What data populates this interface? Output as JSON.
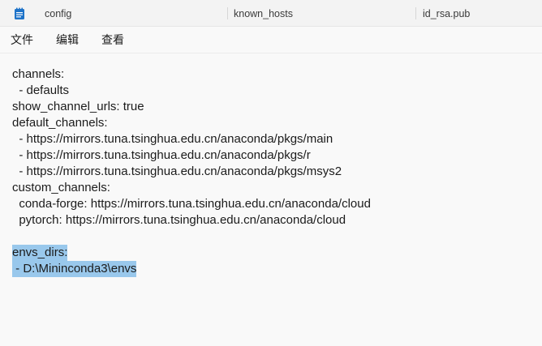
{
  "tabs": [
    {
      "label": "config",
      "active": true
    },
    {
      "label": "known_hosts",
      "active": false
    },
    {
      "label": "id_rsa.pub",
      "active": false
    }
  ],
  "menu": {
    "file": "文件",
    "edit": "编辑",
    "view": "查看"
  },
  "editor": {
    "lines": [
      "channels:",
      "  - defaults",
      "show_channel_urls: true",
      "default_channels:",
      "  - https://mirrors.tuna.tsinghua.edu.cn/anaconda/pkgs/main",
      "  - https://mirrors.tuna.tsinghua.edu.cn/anaconda/pkgs/r",
      "  - https://mirrors.tuna.tsinghua.edu.cn/anaconda/pkgs/msys2",
      "custom_channels:",
      "  conda-forge: https://mirrors.tuna.tsinghua.edu.cn/anaconda/cloud",
      "  pytorch: https://mirrors.tuna.tsinghua.edu.cn/anaconda/cloud",
      "",
      "envs_dirs:",
      " - D:\\Mininconda3\\envs"
    ],
    "selected_lines": [
      11,
      12
    ]
  },
  "colors": {
    "selection": "#99c8ec",
    "icon_blue": "#1e73c8"
  },
  "icons": {
    "tab_icon": "notepad-file-icon"
  }
}
